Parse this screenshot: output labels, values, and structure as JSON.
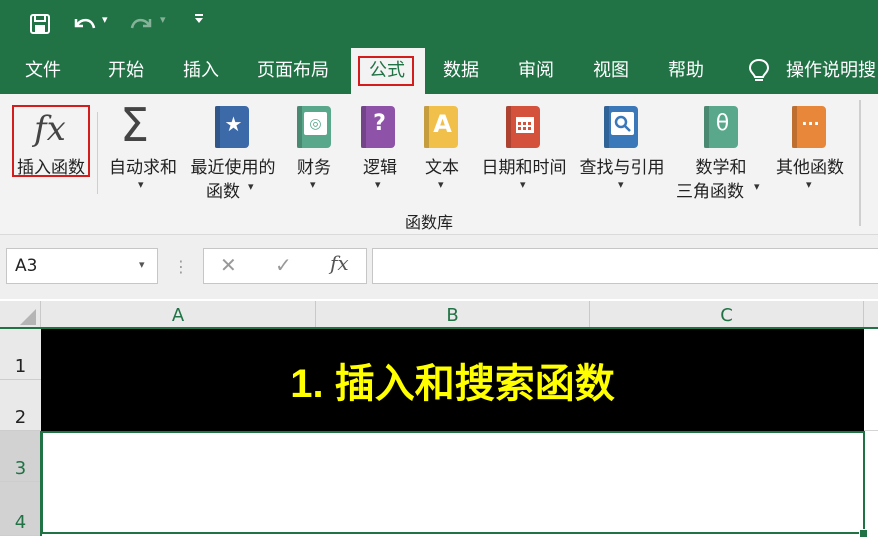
{
  "quick_access": {
    "save_icon": "save-icon",
    "undo_icon": "undo-icon",
    "redo_icon": "redo-icon",
    "customize_icon": "customize-dropdown-icon"
  },
  "tabs": [
    {
      "label": "文件"
    },
    {
      "label": "开始"
    },
    {
      "label": "插入"
    },
    {
      "label": "页面布局"
    },
    {
      "label": "公式",
      "active": true
    },
    {
      "label": "数据"
    },
    {
      "label": "审阅"
    },
    {
      "label": "视图"
    },
    {
      "label": "帮助"
    }
  ],
  "tell_me": {
    "label": "操作说明搜",
    "icon": "lightbulb-icon"
  },
  "ribbon": {
    "insert_function": {
      "glyph": "fx",
      "label": "插入函数"
    },
    "autosum": {
      "glyph": "Σ",
      "label": "自动求和"
    },
    "recent": {
      "label_line1": "最近使用的",
      "label_line2": "函数"
    },
    "financial": {
      "label": "财务"
    },
    "logical": {
      "label": "逻辑",
      "glyph": "?"
    },
    "text": {
      "label": "文本",
      "glyph": "A"
    },
    "datetime": {
      "label": "日期和时间"
    },
    "lookup": {
      "label": "查找与引用"
    },
    "math": {
      "label_line1": "数学和",
      "label_line2": "三角函数",
      "glyph": "θ"
    },
    "more": {
      "label": "其他函数",
      "glyph": "···"
    },
    "group_label": "函数库"
  },
  "colors": {
    "green": "#217346",
    "recent_book": "#3c6aa8",
    "financial_book": "#5aa88c",
    "logical_book": "#8e53a8",
    "text_book": "#f1c04a",
    "datetime_book": "#d4513c",
    "lookup_book": "#3a78b9",
    "math_book": "#5aa88c",
    "more_book": "#e8873a",
    "title_text": "#ffff00",
    "highlight_red": "#d41c1c"
  },
  "formula_bar": {
    "name_box": "A3",
    "cancel_glyph": "✕",
    "enter_glyph": "✓",
    "fx_glyph": "fx",
    "formula": ""
  },
  "sheet": {
    "columns": [
      "A",
      "B",
      "C"
    ],
    "rows": [
      "1",
      "2",
      "3",
      "4"
    ],
    "title_cell": "1. 插入和搜索函数"
  }
}
